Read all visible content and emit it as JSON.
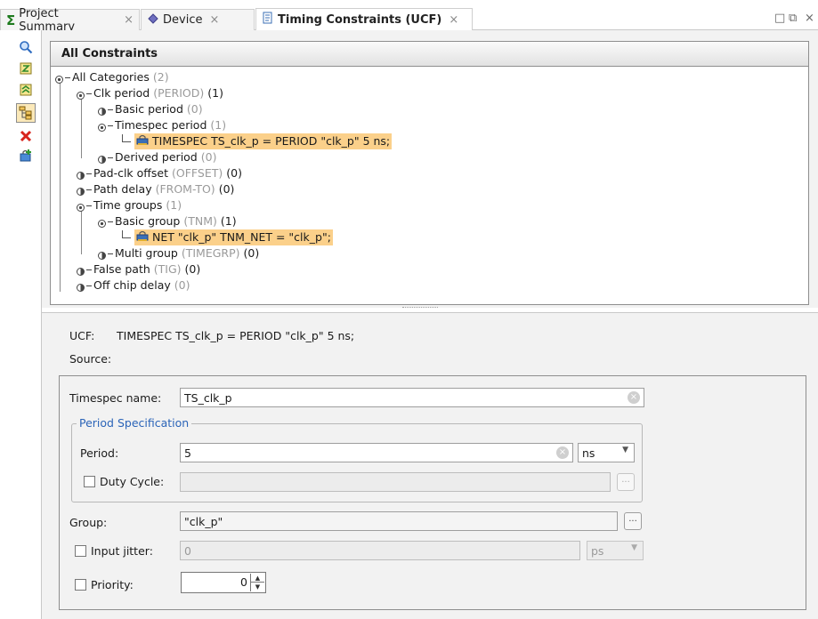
{
  "tabs": [
    {
      "label": "Project Summary",
      "icon": "sigma-icon",
      "active": false
    },
    {
      "label": "Device",
      "icon": "device-icon",
      "active": false
    },
    {
      "label": "Timing Constraints (UCF)",
      "icon": "ucf-file-icon",
      "active": true
    }
  ],
  "window_controls": {
    "restore": "□",
    "maximize": "⧉",
    "close": "×"
  },
  "tab_close": "×",
  "toolbar": [
    "search-icon",
    "constraints-icon",
    "expand-icon",
    "tree-view-icon",
    "delete-icon",
    "add-constraint-icon"
  ],
  "panel_title": "All Constraints",
  "tree": {
    "all_categories": {
      "label": "All Categories",
      "count": "(2)"
    },
    "clk_period": {
      "label": "Clk period",
      "type": "(PERIOD)",
      "count": "(1)"
    },
    "basic_period": {
      "label": "Basic period",
      "count": "(0)"
    },
    "timespec_period": {
      "label": "Timespec period",
      "count": "(1)"
    },
    "timespec_item": "TIMESPEC TS_clk_p = PERIOD \"clk_p\" 5 ns;",
    "derived_period": {
      "label": "Derived period",
      "count": "(0)"
    },
    "pad_clk_offset": {
      "label": "Pad-clk offset",
      "type": "(OFFSET)",
      "count": "(0)"
    },
    "path_delay": {
      "label": "Path delay",
      "type": "(FROM-TO)",
      "count": "(0)"
    },
    "time_groups": {
      "label": "Time groups",
      "count": "(1)"
    },
    "basic_group": {
      "label": "Basic group",
      "type": "(TNM)",
      "count": "(1)"
    },
    "net_item": "NET \"clk_p\" TNM_NET = \"clk_p\";",
    "multi_group": {
      "label": "Multi group",
      "type": "(TIMEGRP)",
      "count": "(0)"
    },
    "false_path": {
      "label": "False path",
      "type": "(TIG)",
      "count": "(0)"
    },
    "off_chip_delay": {
      "label": "Off chip delay",
      "count": "(0)"
    }
  },
  "details": {
    "ucf_label": "UCF:",
    "ucf_value": "TIMESPEC TS_clk_p = PERIOD \"clk_p\" 5 ns;",
    "source_label": "Source:"
  },
  "form": {
    "timespec_name_label": "Timespec name:",
    "timespec_name_value": "TS_clk_p",
    "period_spec_title": "Period Specification",
    "period_label": "Period:",
    "period_value": "5",
    "period_unit": "ns",
    "duty_cycle_label": "Duty Cycle:",
    "duty_cycle_value": "",
    "group_label": "Group:",
    "group_value": "\"clk_p\"",
    "input_jitter_label": "Input jitter:",
    "input_jitter_value": "0",
    "input_jitter_unit": "ps",
    "priority_label": "Priority:",
    "priority_value": "0",
    "browse_label": "...",
    "clear_glyph": "×"
  },
  "colors": {
    "highlight": "#fbd08a",
    "group_title": "#2b64b8",
    "lock_icon": "#3b6fb6"
  }
}
